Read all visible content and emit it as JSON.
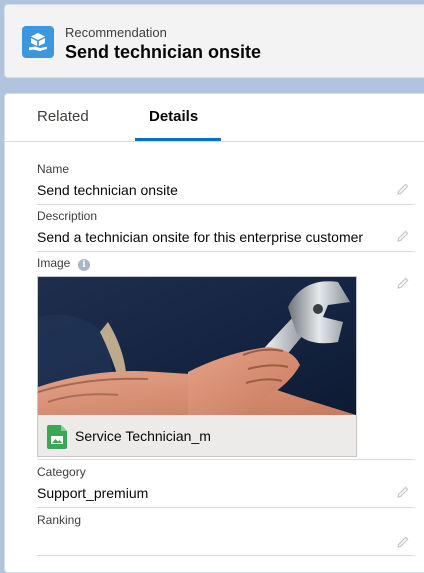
{
  "header": {
    "object_type": "Recommendation",
    "title": "Send technician onsite",
    "icon": "recommendation-icon"
  },
  "tabs": [
    {
      "label": "Related",
      "active": false
    },
    {
      "label": "Details",
      "active": true
    }
  ],
  "fields": {
    "name": {
      "label": "Name",
      "value": "Send technician onsite"
    },
    "description": {
      "label": "Description",
      "value": "Send a technician onsite for this enterprise customer"
    },
    "image": {
      "label": "Image",
      "info_icon": "info-icon",
      "file_name": "Service Technician_m",
      "file_icon": "image-file-icon"
    },
    "category": {
      "label": "Category",
      "value": "Support_premium"
    },
    "ranking": {
      "label": "Ranking",
      "value": ""
    }
  },
  "colors": {
    "background": "#b0c4df",
    "accent": "#0070d2",
    "object_icon": "#3c97dd",
    "file_icon": "#3ba755"
  }
}
